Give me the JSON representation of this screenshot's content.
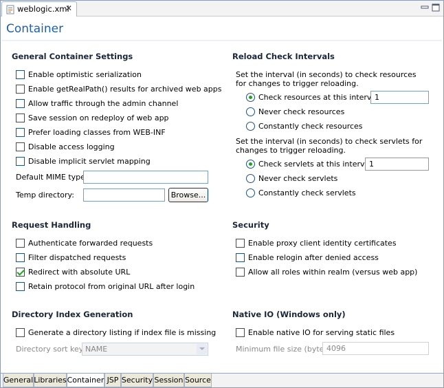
{
  "editor_tab": {
    "title": "weblogic.xml",
    "close": "✕"
  },
  "window_buttons": [
    "minimize-icon",
    "maximize-icon"
  ],
  "form_title": "Container",
  "general": {
    "title": "General Container Settings",
    "checkboxes": [
      {
        "label": "Enable optimistic serialization",
        "checked": false
      },
      {
        "label": "Enable getRealPath() results for archived web apps",
        "checked": false
      },
      {
        "label": "Allow traffic through the admin channel",
        "checked": false
      },
      {
        "label": "Save session on redeploy of web app",
        "checked": false
      },
      {
        "label": "Prefer loading classes from WEB-INF",
        "checked": false
      },
      {
        "label": "Disable access logging",
        "checked": false
      },
      {
        "label": "Disable implicit servlet mapping",
        "checked": false
      }
    ],
    "mime_label": "Default MIME type:",
    "mime_value": "",
    "temp_label": "Temp directory:",
    "temp_value": "",
    "browse": "Browse..."
  },
  "reload": {
    "title": "Reload Check Intervals",
    "resources_desc": "Set the interval (in seconds) to check resources for changes to trigger reloading.",
    "resources_radios": [
      {
        "label": "Check resources at this interval:",
        "checked": true
      },
      {
        "label": "Never check resources",
        "checked": false
      },
      {
        "label": "Constantly check resources",
        "checked": false
      }
    ],
    "resources_interval": "1",
    "servlets_desc": "Set the interval (in seconds) to check servlets for changes to trigger reloading.",
    "servlets_radios": [
      {
        "label": "Check servlets at this interval:",
        "checked": true
      },
      {
        "label": "Never check servlets",
        "checked": false
      },
      {
        "label": "Constantly check servlets",
        "checked": false
      }
    ],
    "servlets_interval": "1"
  },
  "request": {
    "title": "Request Handling",
    "checkboxes": [
      {
        "label": "Authenticate forwarded requests",
        "checked": false
      },
      {
        "label": "Filter dispatched requests",
        "checked": false
      },
      {
        "label": "Redirect with absolute URL",
        "checked": true
      },
      {
        "label": "Retain protocol from original URL after login",
        "checked": false
      }
    ]
  },
  "security": {
    "title": "Security",
    "checkboxes": [
      {
        "label": "Enable proxy client identity certificates",
        "checked": false
      },
      {
        "label": "Enable relogin after denied access",
        "checked": false
      },
      {
        "label": "Allow all roles within realm (versus web app)",
        "checked": false
      }
    ]
  },
  "directory": {
    "title": "Directory Index Generation",
    "checkbox": {
      "label": "Generate a directory listing if index file is missing",
      "checked": false
    },
    "sort_label": "Directory sort key:",
    "sort_value": "NAME"
  },
  "nativeio": {
    "title": "Native IO (Windows only)",
    "checkbox": {
      "label": "Enable native IO for serving static files",
      "checked": false
    },
    "minsize_label": "Minimum file size (bytes):",
    "minsize_value": "4096"
  },
  "bottom_tabs": [
    {
      "label": "General",
      "active": false
    },
    {
      "label": "Libraries",
      "active": false
    },
    {
      "label": "Container",
      "active": true
    },
    {
      "label": "JSP",
      "active": false
    },
    {
      "label": "Security",
      "active": false
    },
    {
      "label": "Session",
      "active": false
    },
    {
      "label": "Source",
      "active": false
    }
  ],
  "colors": {
    "title": "#1f5fad",
    "section": "#1a2639",
    "check": "#21a121",
    "border": "#1c5180"
  }
}
